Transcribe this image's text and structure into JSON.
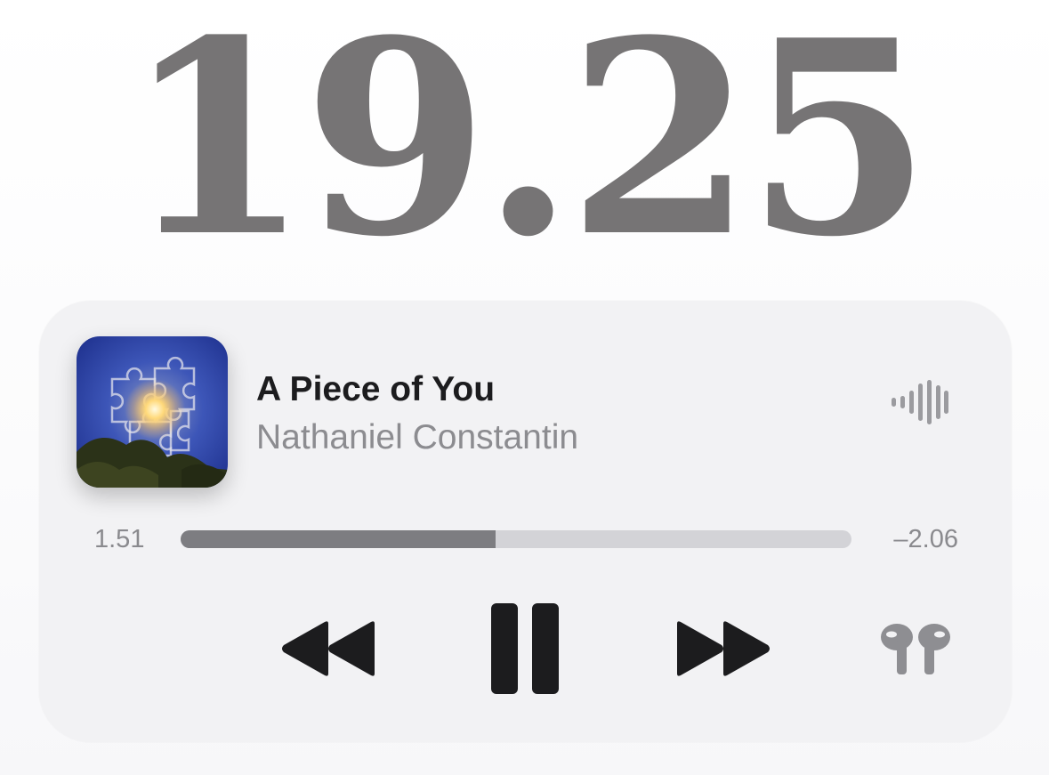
{
  "lock_screen": {
    "clock": "19.25"
  },
  "now_playing": {
    "track_title": "A Piece of You",
    "artist": "Nathaniel Constantin",
    "elapsed": "1.51",
    "remaining": "–2.06",
    "progress_fraction": 0.47,
    "artwork_icon": "album-artwork",
    "controls": {
      "rewind_icon": "rewind-icon",
      "pause_icon": "pause-icon",
      "forward_icon": "fast-forward-icon",
      "output_icon": "airpods-icon",
      "waveform_icon": "waveform-icon"
    }
  },
  "colors": {
    "clock": "#767475",
    "panel": "#f2f2f4",
    "title": "#1c1c1e",
    "secondary": "#8c8c90",
    "progress_fill": "#7d7d81",
    "progress_track": "#d3d3d7",
    "controls": "#1c1c1e"
  }
}
